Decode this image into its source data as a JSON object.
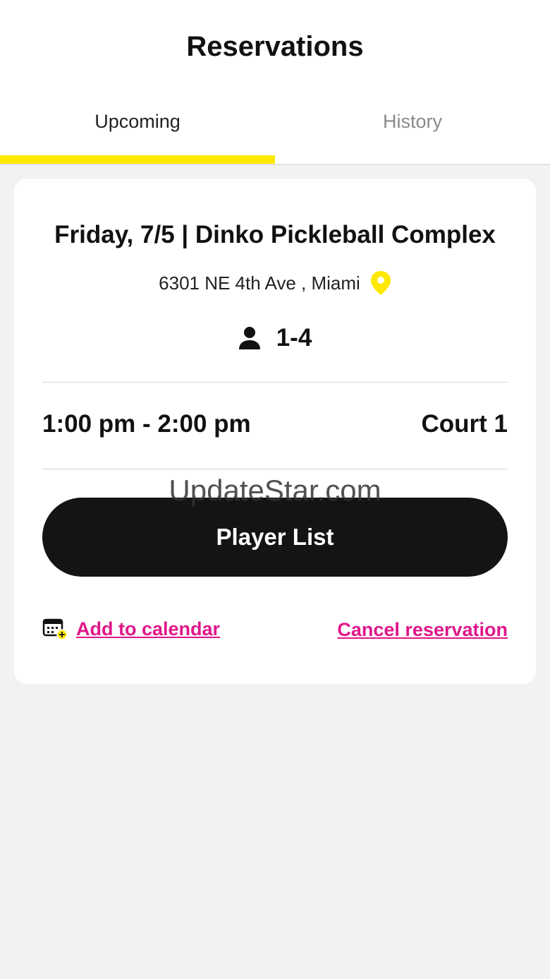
{
  "header": {
    "title": "Reservations",
    "tabs": [
      {
        "label": "Upcoming",
        "active": true
      },
      {
        "label": "History",
        "active": false
      }
    ],
    "accent_color": "#ffe800"
  },
  "reservation": {
    "heading": "Friday, 7/5  |  Dinko Pickleball Complex",
    "address": "6301 NE 4th Ave , Miami",
    "players": "1-4",
    "time": "1:00 pm - 2:00 pm",
    "court": "Court 1",
    "player_list_label": "Player List",
    "add_calendar_label": "Add to calendar",
    "cancel_label": "Cancel reservation",
    "link_color": "#e0168a",
    "icons": [
      "map-pin-icon",
      "person-icon",
      "calendar-add-icon"
    ]
  },
  "watermark": "UpdateStar.com"
}
